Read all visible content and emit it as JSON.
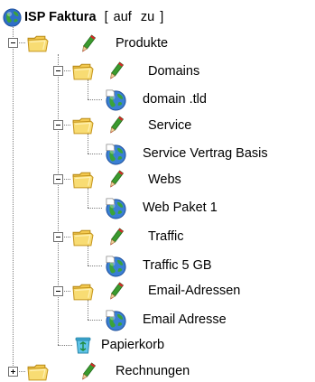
{
  "tree": {
    "root": {
      "title": "ISP Faktura",
      "actions": {
        "open": "[",
        "expand": "auf",
        "collapse": "zu",
        "close": "]"
      }
    },
    "nodes": {
      "produkte": "Produkte",
      "domains": "Domains",
      "domain_tld": "domain .tld",
      "service": "Service",
      "service_vertrag": "Service Vertrag Basis",
      "webs": "Webs",
      "web_paket": "Web Paket 1",
      "traffic": "Traffic",
      "traffic_5gb": "Traffic 5 GB",
      "email_adressen": "Email-Adressen",
      "email_adresse": "Email Adresse",
      "papierkorb": "Papierkorb",
      "rechnungen": "Rechnungen"
    }
  },
  "icons": {
    "root": "globe-icon",
    "category": "folder-icon",
    "edit": "pencil-icon",
    "item": "globe-icon",
    "trash": "recycle-bin-icon",
    "toggle_expanded": "minus-box-icon",
    "toggle_collapsed": "plus-box-icon"
  },
  "colors": {
    "folder_fill": "#f7d86a",
    "folder_edge": "#c99a1e",
    "pencil_body": "#3b9a2e",
    "pencil_tip": "#d8262a",
    "globe_blue": "#2f6fc8",
    "globe_green": "#3aa33a"
  }
}
